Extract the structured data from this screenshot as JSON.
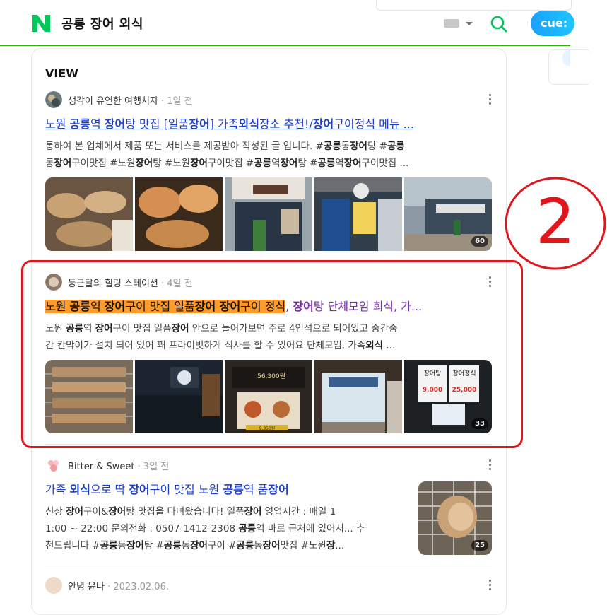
{
  "header": {
    "query": "공릉 장어 외식",
    "cue_label": "cue:"
  },
  "section_title": "VIEW",
  "items": [
    {
      "author": "생각이 유연한 여행처자",
      "time": "1일 전",
      "title": [
        "노원 ",
        "공릉",
        "역 ",
        "장어",
        "탕 맛집 [일품",
        "장어",
        "] 가족",
        "외식",
        "장소 추천!/",
        "장어",
        "구이정식 메뉴 ..."
      ],
      "desc1": [
        "통하여 본 업체에서 제품 또는 서비스를 제공받아 작성된 글 입니다. #",
        "공릉",
        "동",
        "장어",
        "탕 #",
        "공릉"
      ],
      "desc2": [
        "동",
        "장어",
        "구이맛집 #노원",
        "장어",
        "탕 #노원",
        "장어",
        "구이맛집 #",
        "공릉",
        "역",
        "장어",
        "탕 #",
        "공릉",
        "역",
        "장어",
        "구이맛집 ..."
      ],
      "image_count": "60"
    },
    {
      "author": "둥근달의 힐링 스테이션",
      "time": "4일 전",
      "title_hl": [
        "노원 ",
        "공릉",
        "역 ",
        "장어",
        "구이 맛집 일품",
        "장어 장어",
        "구이 정식"
      ],
      "title_rest": [
        ", ",
        "장어",
        "탕 단체모임 회식, 가..."
      ],
      "desc1": [
        "노원 ",
        "공릉",
        "역 ",
        "장어",
        "구이 맛집 일품",
        "장어",
        " 안으로 들어가보면 주로 4인석으로 되어있고 중간중"
      ],
      "desc2": [
        "간 칸막이가 설치 되어 있어 꽤 프라이빗하게 식사를 할 수 있어요 단체모임, 가족",
        "외식",
        " ..."
      ],
      "image_count": "33",
      "sign_texts": {
        "menu1": "장어탕",
        "price1": "9,000",
        "menu2": "장어정식",
        "price2": "25,000",
        "sign_price": "56,300원",
        "bottom_price": "9,350원"
      }
    },
    {
      "author": "Bitter & Sweet",
      "time": "3일 전",
      "title": [
        "가족 ",
        "외식",
        "으로 딱 ",
        "장어",
        "구이 맛집 노원 ",
        "공릉",
        "역 품",
        "장어"
      ],
      "desc1": [
        "신상 ",
        "장어",
        "구이&",
        "장어",
        "탕 맛집을 다녀왔습니다! 일품",
        "장어",
        " 영업시간 : 매일 1"
      ],
      "desc2": [
        "1:00 ~ 22:00 문의전화 : 0507-1412-2308 ",
        "공릉",
        "역 바로 근처에 있어서... 추"
      ],
      "desc3": [
        "천드립니다 #",
        "공릉",
        "동",
        "장어",
        "탕 #",
        "공릉",
        "동",
        "장어",
        "구이 #",
        "공릉",
        "동",
        "장어",
        "맛집 #노원",
        "장",
        "..."
      ],
      "image_count": "25"
    },
    {
      "author": "안녕 윤나",
      "time": "2023.02.06."
    }
  ],
  "annotation": {
    "number": "2",
    "color": "#e0161c"
  }
}
